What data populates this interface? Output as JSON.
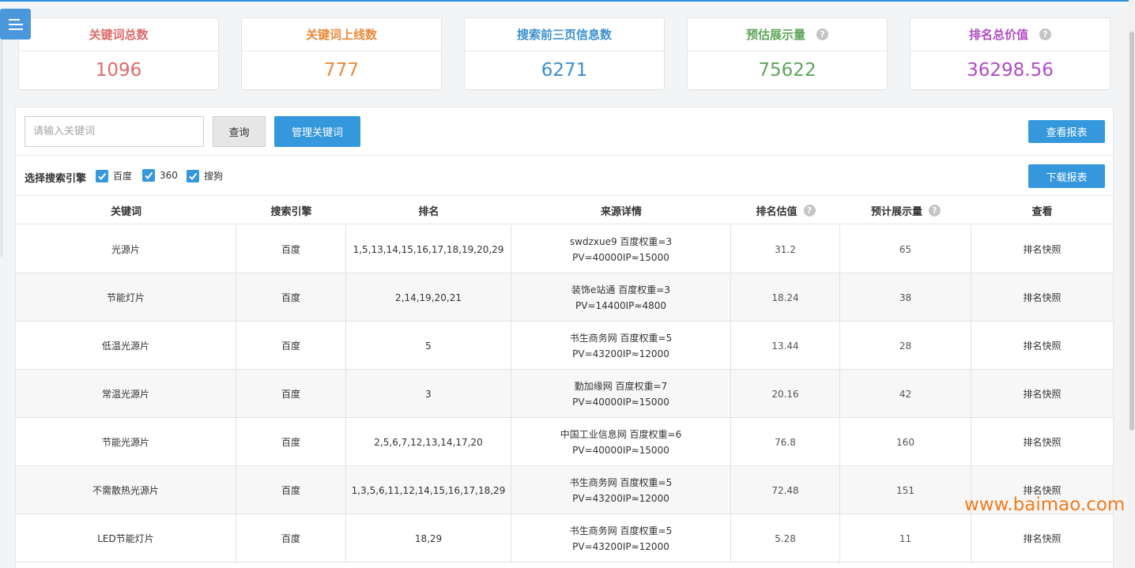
{
  "stats": [
    {
      "label": "关键词总数",
      "value": "1096",
      "color": "#e06a6a",
      "help": false
    },
    {
      "label": "关键词上线数",
      "value": "777",
      "color": "#e98a3a",
      "help": false
    },
    {
      "label": "搜索前三页信息数",
      "value": "6271",
      "color": "#3a8fd0",
      "help": false
    },
    {
      "label": "预估展示量",
      "value": "75622",
      "color": "#5fa55a",
      "help": true
    },
    {
      "label": "排名总价值",
      "value": "36298.56",
      "color": "#b04bc4",
      "help": true
    }
  ],
  "help_mark": "?",
  "search": {
    "placeholder": "请输入关键词",
    "query_label": "查询",
    "manage_label": "管理关键词",
    "report_label": "查看报表"
  },
  "engines": {
    "label": "选择搜索引擎",
    "options": [
      {
        "name": "百度",
        "checked": true
      },
      {
        "name": "360",
        "checked": true
      },
      {
        "name": "搜狗",
        "checked": true
      }
    ],
    "download_label": "下载报表"
  },
  "table": {
    "headers": [
      "关键词",
      "搜索引擎",
      "排名",
      "来源详情",
      "排名估值",
      "预计展示量",
      "查看"
    ],
    "rows": [
      {
        "keyword": "光源片",
        "engine": "百度",
        "rank": "1,5,13,14,15,16,17,18,19,20,29",
        "source1": "swdzxue9 百度权重=3",
        "source2": "PV=40000IP≈15000",
        "value": "31.2",
        "views": "65",
        "action": "排名快照"
      },
      {
        "keyword": "节能灯片",
        "engine": "百度",
        "rank": "2,14,19,20,21",
        "source1": "装饰e站通 百度权重=3",
        "source2": "PV=14400IP≈4800",
        "value": "18.24",
        "views": "38",
        "action": "排名快照"
      },
      {
        "keyword": "低温光源片",
        "engine": "百度",
        "rank": "5",
        "source1": "书生商务网 百度权重=5",
        "source2": "PV=43200IP≈12000",
        "value": "13.44",
        "views": "28",
        "action": "排名快照"
      },
      {
        "keyword": "常温光源片",
        "engine": "百度",
        "rank": "3",
        "source1": "勤加缘网 百度权重=7",
        "source2": "PV=40000IP≈15000",
        "value": "20.16",
        "views": "42",
        "action": "排名快照"
      },
      {
        "keyword": "节能光源片",
        "engine": "百度",
        "rank": "2,5,6,7,12,13,14,17,20",
        "source1": "中国工业信息网 百度权重=6",
        "source2": "PV=40000IP≈15000",
        "value": "76.8",
        "views": "160",
        "action": "排名快照"
      },
      {
        "keyword": "不需散热光源片",
        "engine": "百度",
        "rank": "1,3,5,6,11,12,14,15,16,17,18,29",
        "source1": "书生商务网 百度权重=5",
        "source2": "PV=43200IP≈12000",
        "value": "72.48",
        "views": "151",
        "action": "排名快照"
      },
      {
        "keyword": "LED节能灯片",
        "engine": "百度",
        "rank": "18,29",
        "source1": "书生商务网 百度权重=5",
        "source2": "PV=43200IP≈12000",
        "value": "5.28",
        "views": "11",
        "action": "排名快照"
      }
    ]
  },
  "watermark": "www.baimao.com"
}
